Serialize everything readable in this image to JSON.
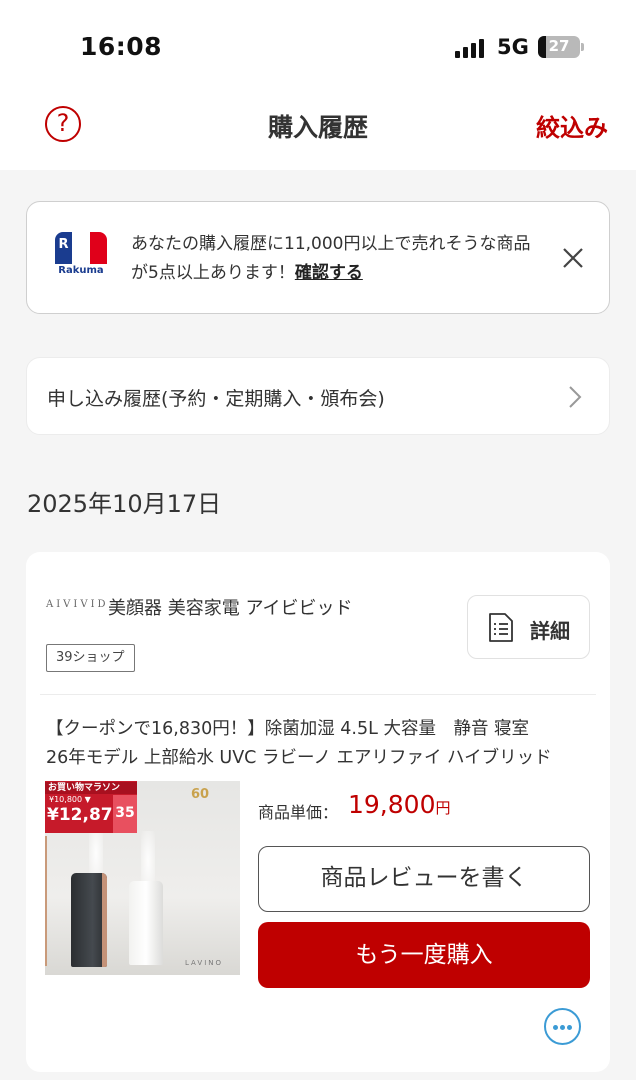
{
  "status_bar": {
    "time": "16:08",
    "network": "5G",
    "battery": "27"
  },
  "header": {
    "title": "購入履歴",
    "filter_label": "絞込み",
    "help_icon": "question-circle-icon"
  },
  "banner": {
    "logo_text": "Rakuma",
    "logo_letter": "R",
    "message": "あなたの購入履歴に11,000円以上で売れそうな商品が5点以上あります！",
    "link_label": "確認する"
  },
  "subscription": {
    "label": "申し込み履歴(予約・定期購入・頒布会)"
  },
  "orders": [
    {
      "date": "2025年10月17日",
      "shop_logo": "AIVIVID",
      "shop_name": "美顔器 美容家電 アイビビッド",
      "shop_badge": "39ショップ",
      "detail_label": "詳細",
      "product_line1": "【クーポンで16,830円！】除菌加湿 4.5L 大容量　静音 寝室",
      "product_line2": "26年モデル 上部給水 UVC ラビーノ エアリファイ ハイブリッド",
      "price_label": "商品単価：",
      "price": "19,800",
      "price_unit": "円",
      "review_label": "商品レビューを書く",
      "rebuy_label": "もう一度購入",
      "image": {
        "promo_title": "お買い物マラソン",
        "promo_old_price": "¥10,800 ▼",
        "promo_price": "¥12,870",
        "promo_percent": "35",
        "sales_badge": "60",
        "brand_mark": "LAVINO"
      }
    }
  ]
}
